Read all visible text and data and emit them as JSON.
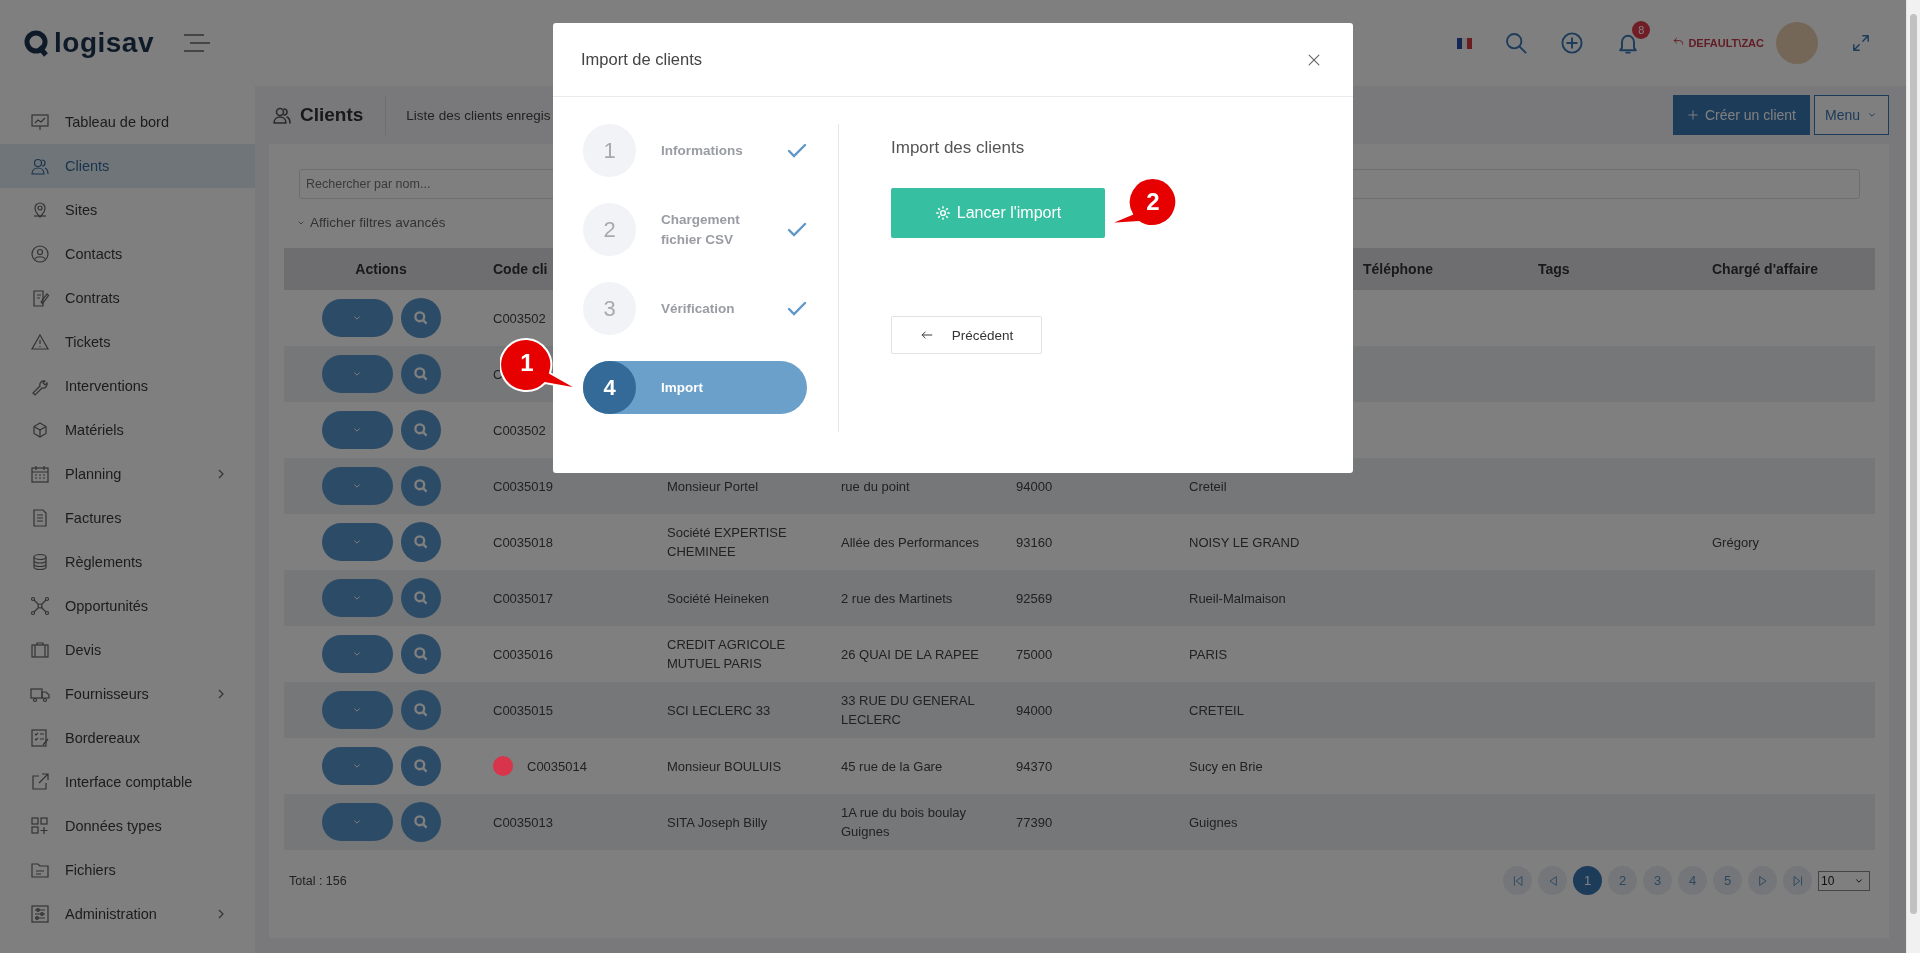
{
  "header": {
    "logo": "logisav",
    "notification_count": "8",
    "user": "DEFAULT\\ZAC"
  },
  "sidebar": {
    "items": [
      {
        "label": "Tableau de bord",
        "selected": false,
        "has_submenu": false
      },
      {
        "label": "Clients",
        "selected": true,
        "has_submenu": false
      },
      {
        "label": "Sites",
        "selected": false,
        "has_submenu": false
      },
      {
        "label": "Contacts",
        "selected": false,
        "has_submenu": false
      },
      {
        "label": "Contrats",
        "selected": false,
        "has_submenu": false
      },
      {
        "label": "Tickets",
        "selected": false,
        "has_submenu": false
      },
      {
        "label": "Interventions",
        "selected": false,
        "has_submenu": false
      },
      {
        "label": "Matériels",
        "selected": false,
        "has_submenu": false
      },
      {
        "label": "Planning",
        "selected": false,
        "has_submenu": true
      },
      {
        "label": "Factures",
        "selected": false,
        "has_submenu": false
      },
      {
        "label": "Règlements",
        "selected": false,
        "has_submenu": false
      },
      {
        "label": "Opportunités",
        "selected": false,
        "has_submenu": false
      },
      {
        "label": "Devis",
        "selected": false,
        "has_submenu": false
      },
      {
        "label": "Fournisseurs",
        "selected": false,
        "has_submenu": true
      },
      {
        "label": "Bordereaux",
        "selected": false,
        "has_submenu": false
      },
      {
        "label": "Interface comptable",
        "selected": false,
        "has_submenu": false
      },
      {
        "label": "Données types",
        "selected": false,
        "has_submenu": false
      },
      {
        "label": "Fichiers",
        "selected": false,
        "has_submenu": false
      },
      {
        "label": "Administration",
        "selected": false,
        "has_submenu": true
      }
    ]
  },
  "page": {
    "title": "Clients",
    "subtitle": "Liste des clients enregis",
    "buttons": [
      {
        "label": "Créer un client",
        "kind": "primary"
      },
      {
        "label": "Menu",
        "kind": "menu"
      }
    ]
  },
  "search": {
    "placeholder": "Rechercher par nom..."
  },
  "filters_toggle": "Afficher filtres avancés",
  "table": {
    "columns": [
      "Actions",
      "Code cli",
      null,
      null,
      null,
      null,
      "Téléphone",
      "Tags",
      "Chargé d'affaire"
    ],
    "rows": [
      {
        "code": "C003502"
      },
      {
        "code": "C"
      },
      {
        "code": "C003502"
      },
      {
        "code": "C0035019",
        "name": "Monsieur Portel",
        "address": "rue du point",
        "postcode": "94000",
        "city": "Creteil"
      },
      {
        "code": "C0035018",
        "name": "Société EXPERTISE CHEMINEE",
        "address": "Allée des Performances",
        "postcode": "93160",
        "city": "NOISY LE GRAND",
        "account_manager": "Grégory"
      },
      {
        "code": "C0035017",
        "name": "Société Heineken",
        "address": "2 rue des Martinets",
        "postcode": "92569",
        "city": "Rueil-Malmaison"
      },
      {
        "code": "C0035016",
        "name": "CREDIT AGRICOLE MUTUEL PARIS",
        "address": "26 QUAI DE LA RAPEE",
        "postcode": "75000",
        "city": "PARIS"
      },
      {
        "code": "C0035015",
        "name": "SCI LECLERC 33",
        "address": "33 RUE DU GENERAL LECLERC",
        "postcode": "94000",
        "city": "CRETEIL"
      },
      {
        "code": "C0035014",
        "color": "#d8344a",
        "name": "Monsieur BOULUIS",
        "address": "45 rue de la Gare",
        "postcode": "94370",
        "city": "Sucy en Brie"
      },
      {
        "code": "C0035013",
        "name": "SITA Joseph Billy",
        "address": "1A rue du bois boulay Guignes",
        "postcode": "77390",
        "city": "Guignes"
      }
    ]
  },
  "footer": {
    "total": "Total : 156",
    "pages": [
      {
        "label": "1",
        "selected": true
      },
      {
        "label": "2",
        "selected": false
      },
      {
        "label": "3",
        "selected": false
      },
      {
        "label": "4",
        "selected": false
      },
      {
        "label": "5",
        "selected": false
      }
    ],
    "page_size": "10"
  },
  "modal": {
    "title": "Import de clients",
    "steps": [
      {
        "number": "1",
        "label": "Informations",
        "done": true,
        "selected": false
      },
      {
        "number": "2",
        "label": "Chargement fichier CSV",
        "done": true,
        "selected": false
      },
      {
        "number": "3",
        "label": "Vérification",
        "done": true,
        "selected": false
      },
      {
        "number": "4",
        "label": "Import",
        "done": false,
        "selected": true
      }
    ],
    "section_title": "Import des clients",
    "buttons": [
      {
        "label": "Lancer l'import",
        "kind": "primary"
      },
      {
        "label": "Précédent",
        "kind": "back"
      }
    ]
  },
  "callouts": [
    {
      "label": "1"
    },
    {
      "label": "2"
    }
  ]
}
